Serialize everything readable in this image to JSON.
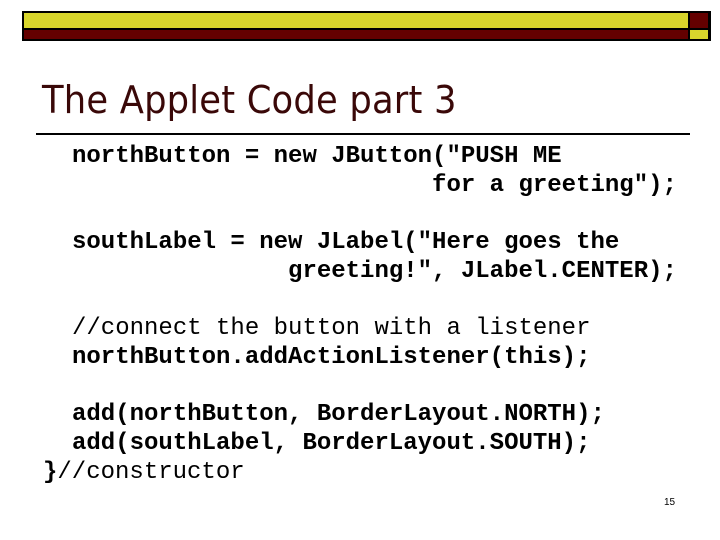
{
  "header": {
    "accent_yellow": "#d8d62c",
    "accent_maroon": "#640000"
  },
  "slide": {
    "title": "The Applet Code part 3",
    "title_color": "#3a0808",
    "page_number": "15"
  },
  "code": {
    "lines": [
      "northButton = new JButton(\"PUSH ME",
      "                         for a greeting\");",
      "southLabel = new JLabel(\"Here goes the",
      "               greeting!\", JLabel.CENTER);",
      "//connect the button with a listener",
      "northButton.addActionListener(this);",
      "add(northButton, BorderLayout.NORTH);",
      "add(southLabel, BorderLayout.SOUTH);",
      "}//constructor"
    ]
  }
}
